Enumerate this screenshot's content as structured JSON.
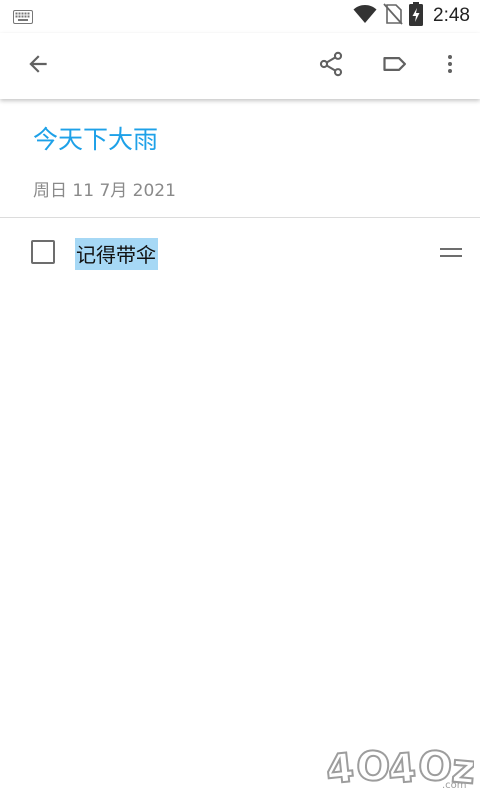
{
  "status_bar": {
    "time": "2:48",
    "icons": [
      "keyboard-icon",
      "wifi-icon",
      "no-sim-icon",
      "battery-charging-icon"
    ]
  },
  "toolbar": {
    "icons": [
      "back-arrow-icon",
      "share-icon",
      "label-icon",
      "more-vert-icon"
    ]
  },
  "note": {
    "title": "今天下大雨",
    "date": "周日 11 7月 2021",
    "checklist": [
      {
        "text": "记得带伞",
        "checked": false,
        "selected": true
      }
    ]
  },
  "watermark": {
    "text": "4O4Oz.com"
  },
  "colors": {
    "title": "#1ea1e8",
    "date": "#8a8a8a",
    "selection": "#a6d8f5",
    "icon": "#616161",
    "divider": "#dcdcdc"
  }
}
